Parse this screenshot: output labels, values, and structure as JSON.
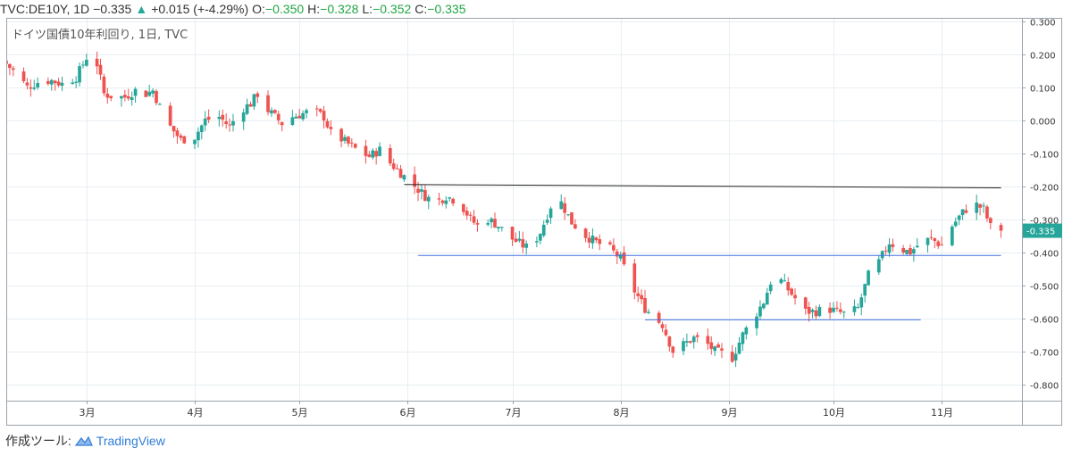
{
  "header": {
    "symbol": "TVC:DE10Y, 1D",
    "last": "−0.335",
    "change": "+0.015 (+-4.29%)",
    "open_label": "O:",
    "open": "−0.350",
    "high_label": "H:",
    "high": "−0.328",
    "low_label": "L:",
    "low": "−0.352",
    "close_label": "C:",
    "close": "−0.335"
  },
  "footer": {
    "prefix": "作成ツール:",
    "brand": "TradingView"
  },
  "colors": {
    "up": "#26a69a",
    "down": "#ef5350",
    "grid": "#e8eef2",
    "support_line": "#4472e0",
    "resistance_line": "#222222",
    "price_tag": "#26a69a"
  },
  "chart_data": {
    "type": "candlestick",
    "title": "ドイツ国債10年利回り, 1日, TVC",
    "ylim": [
      -0.85,
      0.31
    ],
    "y_ticks": [
      "0.300",
      "0.200",
      "0.100",
      "0.000",
      "-0.100",
      "-0.200",
      "-0.300",
      "-0.400",
      "-0.500",
      "-0.600",
      "-0.700",
      "-0.800"
    ],
    "y_tick_values": [
      0.3,
      0.2,
      0.1,
      0.0,
      -0.1,
      -0.2,
      -0.3,
      -0.4,
      -0.5,
      -0.6,
      -0.7,
      -0.8
    ],
    "x_ticks": [
      "3月",
      "4月",
      "5月",
      "6月",
      "7月",
      "8月",
      "9月",
      "10月",
      "11月"
    ],
    "x_tick_dates": [
      "2019-03-01",
      "2019-04-01",
      "2019-05-01",
      "2019-06-01",
      "2019-07-01",
      "2019-08-01",
      "2019-09-01",
      "2019-10-01",
      "2019-11-01"
    ],
    "x_start": "2019-02-06",
    "x_end": "2019-11-24",
    "last_price_label": "-0.335",
    "last_price": -0.335,
    "close_anchors": [
      [
        "2019-02-06",
        0.17
      ],
      [
        "2019-02-09",
        0.14
      ],
      [
        "2019-02-12",
        0.1
      ],
      [
        "2019-02-16",
        0.12
      ],
      [
        "2019-02-19",
        0.12
      ],
      [
        "2019-02-22",
        0.11
      ],
      [
        "2019-02-26",
        0.13
      ],
      [
        "2019-03-01",
        0.19
      ],
      [
        "2019-03-04",
        0.17
      ],
      [
        "2019-03-06",
        0.08
      ],
      [
        "2019-03-09",
        0.07
      ],
      [
        "2019-03-12",
        0.07
      ],
      [
        "2019-03-15",
        0.09
      ],
      [
        "2019-03-18",
        0.08
      ],
      [
        "2019-03-20",
        0.09
      ],
      [
        "2019-03-22",
        0.04
      ],
      [
        "2019-03-25",
        -0.02
      ],
      [
        "2019-03-28",
        -0.06
      ],
      [
        "2019-04-01",
        -0.05
      ],
      [
        "2019-04-04",
        0.0
      ],
      [
        "2019-04-08",
        0.01
      ],
      [
        "2019-04-11",
        -0.02
      ],
      [
        "2019-04-14",
        0.03
      ],
      [
        "2019-04-17",
        0.05
      ],
      [
        "2019-04-19",
        0.08
      ],
      [
        "2019-04-22",
        0.03
      ],
      [
        "2019-04-26",
        -0.01
      ],
      [
        "2019-04-29",
        0.01
      ],
      [
        "2019-05-02",
        0.02
      ],
      [
        "2019-05-05",
        0.03
      ],
      [
        "2019-05-08",
        0.01
      ],
      [
        "2019-05-10",
        -0.04
      ],
      [
        "2019-05-12",
        -0.05
      ],
      [
        "2019-05-16",
        -0.08
      ],
      [
        "2019-05-19",
        -0.1
      ],
      [
        "2019-05-21",
        -0.11
      ],
      [
        "2019-05-24",
        -0.09
      ],
      [
        "2019-05-27",
        -0.13
      ],
      [
        "2019-05-31",
        -0.17
      ],
      [
        "2019-06-03",
        -0.2
      ],
      [
        "2019-06-06",
        -0.23
      ],
      [
        "2019-06-09",
        -0.25
      ],
      [
        "2019-06-12",
        -0.23
      ],
      [
        "2019-06-16",
        -0.25
      ],
      [
        "2019-06-19",
        -0.3
      ],
      [
        "2019-06-21",
        -0.32
      ],
      [
        "2019-06-24",
        -0.3
      ],
      [
        "2019-06-27",
        -0.32
      ],
      [
        "2019-07-01",
        -0.36
      ],
      [
        "2019-07-04",
        -0.38
      ],
      [
        "2019-07-06",
        -0.39
      ],
      [
        "2019-07-09",
        -0.34
      ],
      [
        "2019-07-12",
        -0.26
      ],
      [
        "2019-07-15",
        -0.25
      ],
      [
        "2019-07-18",
        -0.31
      ],
      [
        "2019-07-22",
        -0.35
      ],
      [
        "2019-07-25",
        -0.37
      ],
      [
        "2019-07-29",
        -0.39
      ],
      [
        "2019-08-01",
        -0.42
      ],
      [
        "2019-08-04",
        -0.5
      ],
      [
        "2019-08-08",
        -0.57
      ],
      [
        "2019-08-11",
        -0.6
      ],
      [
        "2019-08-13",
        -0.62
      ],
      [
        "2019-08-16",
        -0.7
      ],
      [
        "2019-08-19",
        -0.68
      ],
      [
        "2019-08-22",
        -0.66
      ],
      [
        "2019-08-25",
        -0.67
      ],
      [
        "2019-08-28",
        -0.7
      ],
      [
        "2019-08-31",
        -0.71
      ],
      [
        "2019-09-02",
        -0.72
      ],
      [
        "2019-09-05",
        -0.65
      ],
      [
        "2019-09-08",
        -0.6
      ],
      [
        "2019-09-11",
        -0.55
      ],
      [
        "2019-09-14",
        -0.46
      ],
      [
        "2019-09-17",
        -0.5
      ],
      [
        "2019-09-20",
        -0.54
      ],
      [
        "2019-09-23",
        -0.58
      ],
      [
        "2019-09-26",
        -0.58
      ],
      [
        "2019-09-29",
        -0.57
      ],
      [
        "2019-10-02",
        -0.58
      ],
      [
        "2019-10-05",
        -0.59
      ],
      [
        "2019-10-08",
        -0.57
      ],
      [
        "2019-10-11",
        -0.47
      ],
      [
        "2019-10-14",
        -0.43
      ],
      [
        "2019-10-17",
        -0.37
      ],
      [
        "2019-10-20",
        -0.39
      ],
      [
        "2019-10-23",
        -0.4
      ],
      [
        "2019-10-26",
        -0.37
      ],
      [
        "2019-10-29",
        -0.36
      ],
      [
        "2019-11-01",
        -0.38
      ],
      [
        "2019-11-04",
        -0.32
      ],
      [
        "2019-11-07",
        -0.28
      ],
      [
        "2019-11-10",
        -0.25
      ],
      [
        "2019-11-13",
        -0.27
      ],
      [
        "2019-11-16",
        -0.35
      ],
      [
        "2019-11-18",
        -0.335
      ]
    ],
    "trend_lines": [
      {
        "x1": "2019-05-31",
        "y1": -0.195,
        "x2": "2019-11-18",
        "y2": -0.205,
        "color": "#222222"
      },
      {
        "x1": "2019-06-04",
        "y1": -0.41,
        "x2": "2019-11-18",
        "y2": -0.41,
        "color": "#4472e0"
      },
      {
        "x1": "2019-08-08",
        "y1": -0.605,
        "x2": "2019-10-26",
        "y2": -0.605,
        "color": "#4472e0"
      }
    ]
  }
}
